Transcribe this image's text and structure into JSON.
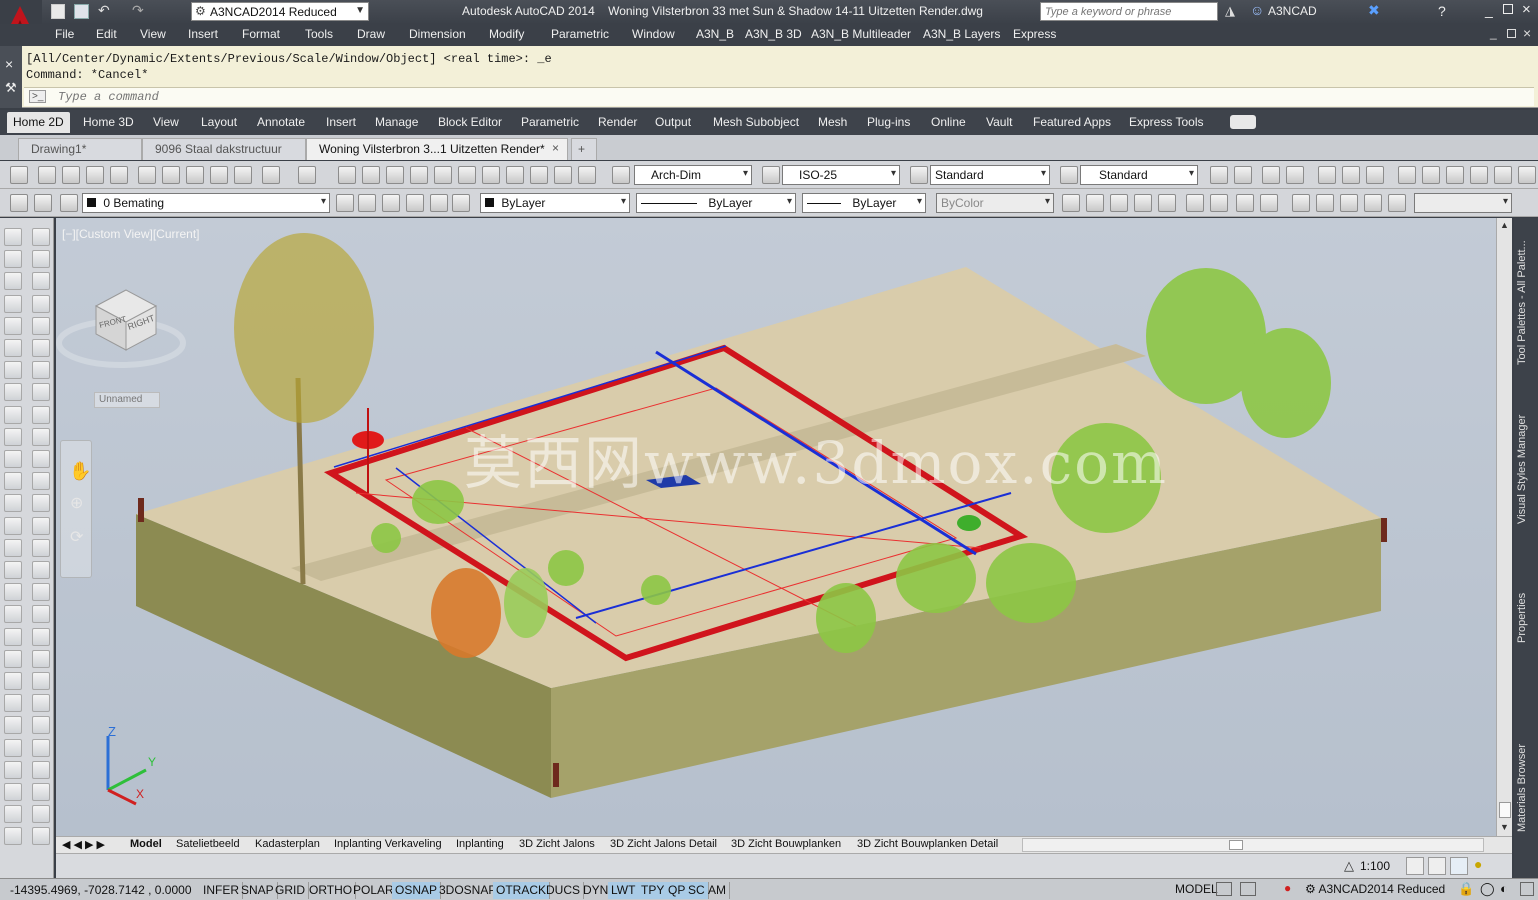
{
  "app": {
    "logo_letter": "A",
    "title": "Autodesk AutoCAD 2014    Woning Vilsterbron 33 met Sun & Shadow 14-11 Uitzetten Render.dwg",
    "workspace": "A3NCAD2014 Reduced",
    "search_placeholder": "Type a keyword or phrase",
    "user": "A3NCAD"
  },
  "menus": [
    "File",
    "Edit",
    "View",
    "Insert",
    "Format",
    "Tools",
    "Draw",
    "Dimension",
    "Modify",
    "Parametric",
    "Window",
    "A3N_B",
    "A3N_B 3D",
    "A3N_B Multileader",
    "A3N_B Layers",
    "Express"
  ],
  "command": {
    "history1": "[All/Center/Dynamic/Extents/Previous/Scale/Window/Object] <real time>: _e",
    "history2": "Command: *Cancel*",
    "prompt_placeholder": "Type a command",
    "prompt_symbol": ">_"
  },
  "ribbon_tabs": [
    "Home 2D",
    "Home 3D",
    "View",
    "Layout",
    "Annotate",
    "Insert",
    "Manage",
    "Block Editor",
    "Parametric",
    "Render",
    "Output",
    "Mesh Subobject",
    "Mesh",
    "Plug-ins",
    "Online",
    "Vault",
    "Featured Apps",
    "Express Tools"
  ],
  "doc_tabs": [
    "Drawing1*",
    "9096 Staal dakstructuur",
    "Woning Vilsterbron 3...1 Uitzetten Render*"
  ],
  "toolbar": {
    "dimstyle": "Arch-Dim",
    "textstyle": "ISO-25",
    "tablestyle": "Standard",
    "mleaderstyle": "Standard",
    "layer": "0 Bemating",
    "color": "ByLayer",
    "linetype": "ByLayer",
    "lineweight": "ByLayer",
    "plotstyle": "ByColor"
  },
  "viewport": {
    "label": "[−][Custom View][Current]",
    "viewcube_face1": "FRONT",
    "viewcube_face2": "RIGHT",
    "ucs_menu": "Unnamed",
    "axis_x": "X",
    "axis_y": "Y",
    "axis_z": "Z",
    "watermark": "莫西网www.3dmox.com"
  },
  "palettes": [
    "Tool Palettes - All Palett...",
    "Visual Styles Manager",
    "Properties",
    "Materials Browser"
  ],
  "layout_tabs": [
    "Model",
    "Satelietbeeld",
    "Kadasterplan",
    "Inplanting Verkaveling",
    "Inplanting",
    "3D Zicht Jalons",
    "3D Zicht Jalons Detail",
    "3D Zicht Bouwplanken",
    "3D Zicht Bouwplanken Detail"
  ],
  "annotation_scale": "1:100",
  "status": {
    "coords": "-14395.4969, -7028.7142 , 0.0000",
    "toggles": [
      "INFER",
      "SNAP",
      "GRID",
      "ORTHO",
      "POLAR",
      "OSNAP",
      "3DOSNAP",
      "OTRACK",
      "DUCS",
      "DYN",
      "LWT",
      "TPY",
      "QP",
      "SC",
      "AM"
    ],
    "active_toggles": [
      "OSNAP",
      "OTRACK",
      "LWT",
      "TPY",
      "QP",
      "SC"
    ],
    "model": "MODEL",
    "workspace": "A3NCAD2014 Reduced"
  },
  "colors": {
    "ground_top": "#d8ccaa",
    "ground_side": "#8b8c52",
    "frame_red": "#d0141c",
    "line_blue": "#1a2fd6",
    "viewport_bg": "#bac3cf"
  }
}
